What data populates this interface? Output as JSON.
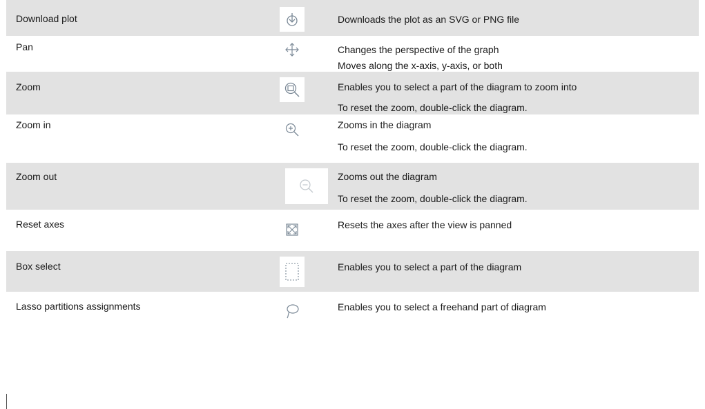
{
  "rows": [
    {
      "name": "Download plot",
      "icon": "download-icon",
      "desc": [
        "Downloads the plot as an SVG or PNG file"
      ]
    },
    {
      "name": "Pan",
      "icon": "pan-icon",
      "desc": [
        "Changes the perspective of the graph",
        "Moves along the x-axis, y-axis, or both"
      ]
    },
    {
      "name": "Zoom",
      "icon": "zoom-icon",
      "desc": [
        "Enables you to select a part of the diagram to zoom into",
        "To reset the zoom, double-click the diagram."
      ]
    },
    {
      "name": "Zoom in",
      "icon": "zoom-in-icon",
      "desc": [
        "Zooms in the diagram",
        "To reset the zoom, double-click the diagram."
      ]
    },
    {
      "name": "Zoom out",
      "icon": "zoom-out-icon",
      "desc": [
        "Zooms out the diagram",
        "To reset the zoom, double-click the diagram."
      ]
    },
    {
      "name": "Reset axes",
      "icon": "reset-axes-icon",
      "desc": [
        "Resets the axes after the view is panned"
      ]
    },
    {
      "name": "Box select",
      "icon": "box-select-icon",
      "desc": [
        "Enables you to select a part of the diagram"
      ]
    },
    {
      "name": "Lasso partitions assignments",
      "icon": "lasso-icon",
      "desc": [
        "Enables you to select a freehand part of diagram"
      ]
    }
  ],
  "colors": {
    "shaded_row": "#e2e2e2",
    "icon_stroke": "#7a8896",
    "text": "#1a1a1a"
  }
}
